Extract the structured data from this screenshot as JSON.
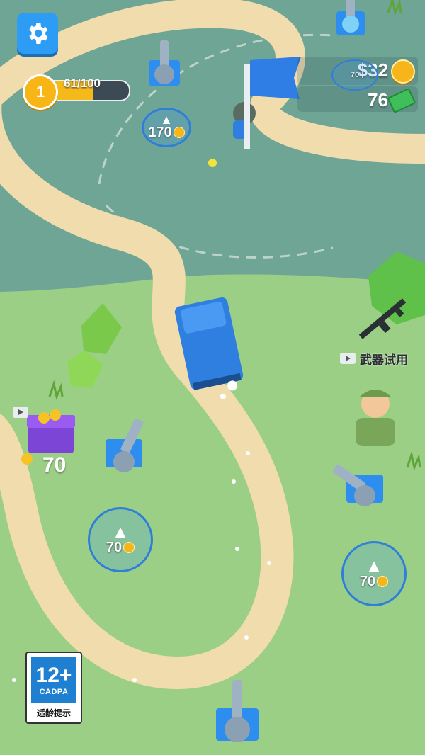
{
  "hud": {
    "level": {
      "number": "1",
      "progress_text": "61/100",
      "progress_fraction": 0.61
    },
    "money": "$32",
    "cash": "76"
  },
  "upgrades": [
    {
      "id": "top-turret",
      "price": "170"
    },
    {
      "id": "left-turret",
      "price": "70"
    },
    {
      "id": "right-turret",
      "price": "70"
    },
    {
      "id": "top-right",
      "price": "70"
    }
  ],
  "weapon_trial": {
    "label": "武器试用"
  },
  "chest": {
    "price": "70"
  },
  "age_rating": {
    "rating": "12+",
    "org": "CADPA",
    "caption": "适龄提示"
  },
  "colors": {
    "grass": "#8fbf7a",
    "grass_dark": "#6ea595",
    "road": "#f1dcae",
    "player_blue": "#2f7fe0",
    "accent_gold": "#f5b51b"
  }
}
